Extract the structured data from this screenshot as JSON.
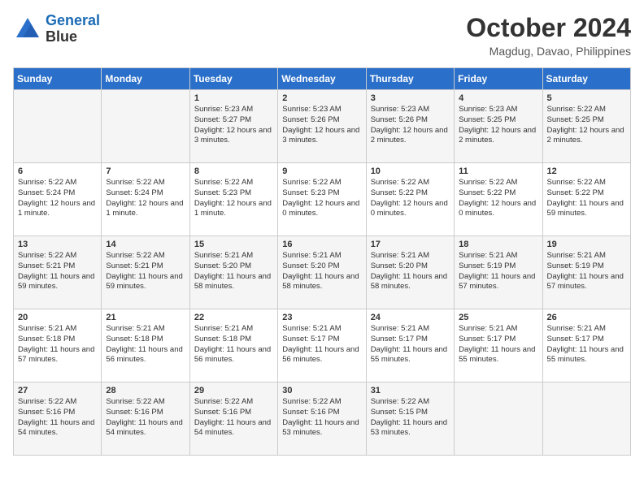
{
  "header": {
    "logo_line1": "General",
    "logo_line2": "Blue",
    "month": "October 2024",
    "location": "Magdug, Davao, Philippines"
  },
  "days_of_week": [
    "Sunday",
    "Monday",
    "Tuesday",
    "Wednesday",
    "Thursday",
    "Friday",
    "Saturday"
  ],
  "weeks": [
    [
      {
        "day": "",
        "content": ""
      },
      {
        "day": "",
        "content": ""
      },
      {
        "day": "1",
        "content": "Sunrise: 5:23 AM\nSunset: 5:27 PM\nDaylight: 12 hours\nand 3 minutes."
      },
      {
        "day": "2",
        "content": "Sunrise: 5:23 AM\nSunset: 5:26 PM\nDaylight: 12 hours\nand 3 minutes."
      },
      {
        "day": "3",
        "content": "Sunrise: 5:23 AM\nSunset: 5:26 PM\nDaylight: 12 hours\nand 2 minutes."
      },
      {
        "day": "4",
        "content": "Sunrise: 5:23 AM\nSunset: 5:25 PM\nDaylight: 12 hours\nand 2 minutes."
      },
      {
        "day": "5",
        "content": "Sunrise: 5:22 AM\nSunset: 5:25 PM\nDaylight: 12 hours\nand 2 minutes."
      }
    ],
    [
      {
        "day": "6",
        "content": "Sunrise: 5:22 AM\nSunset: 5:24 PM\nDaylight: 12 hours\nand 1 minute."
      },
      {
        "day": "7",
        "content": "Sunrise: 5:22 AM\nSunset: 5:24 PM\nDaylight: 12 hours\nand 1 minute."
      },
      {
        "day": "8",
        "content": "Sunrise: 5:22 AM\nSunset: 5:23 PM\nDaylight: 12 hours\nand 1 minute."
      },
      {
        "day": "9",
        "content": "Sunrise: 5:22 AM\nSunset: 5:23 PM\nDaylight: 12 hours\nand 0 minutes."
      },
      {
        "day": "10",
        "content": "Sunrise: 5:22 AM\nSunset: 5:22 PM\nDaylight: 12 hours\nand 0 minutes."
      },
      {
        "day": "11",
        "content": "Sunrise: 5:22 AM\nSunset: 5:22 PM\nDaylight: 12 hours\nand 0 minutes."
      },
      {
        "day": "12",
        "content": "Sunrise: 5:22 AM\nSunset: 5:22 PM\nDaylight: 11 hours\nand 59 minutes."
      }
    ],
    [
      {
        "day": "13",
        "content": "Sunrise: 5:22 AM\nSunset: 5:21 PM\nDaylight: 11 hours\nand 59 minutes."
      },
      {
        "day": "14",
        "content": "Sunrise: 5:22 AM\nSunset: 5:21 PM\nDaylight: 11 hours\nand 59 minutes."
      },
      {
        "day": "15",
        "content": "Sunrise: 5:21 AM\nSunset: 5:20 PM\nDaylight: 11 hours\nand 58 minutes."
      },
      {
        "day": "16",
        "content": "Sunrise: 5:21 AM\nSunset: 5:20 PM\nDaylight: 11 hours\nand 58 minutes."
      },
      {
        "day": "17",
        "content": "Sunrise: 5:21 AM\nSunset: 5:20 PM\nDaylight: 11 hours\nand 58 minutes."
      },
      {
        "day": "18",
        "content": "Sunrise: 5:21 AM\nSunset: 5:19 PM\nDaylight: 11 hours\nand 57 minutes."
      },
      {
        "day": "19",
        "content": "Sunrise: 5:21 AM\nSunset: 5:19 PM\nDaylight: 11 hours\nand 57 minutes."
      }
    ],
    [
      {
        "day": "20",
        "content": "Sunrise: 5:21 AM\nSunset: 5:18 PM\nDaylight: 11 hours\nand 57 minutes."
      },
      {
        "day": "21",
        "content": "Sunrise: 5:21 AM\nSunset: 5:18 PM\nDaylight: 11 hours\nand 56 minutes."
      },
      {
        "day": "22",
        "content": "Sunrise: 5:21 AM\nSunset: 5:18 PM\nDaylight: 11 hours\nand 56 minutes."
      },
      {
        "day": "23",
        "content": "Sunrise: 5:21 AM\nSunset: 5:17 PM\nDaylight: 11 hours\nand 56 minutes."
      },
      {
        "day": "24",
        "content": "Sunrise: 5:21 AM\nSunset: 5:17 PM\nDaylight: 11 hours\nand 55 minutes."
      },
      {
        "day": "25",
        "content": "Sunrise: 5:21 AM\nSunset: 5:17 PM\nDaylight: 11 hours\nand 55 minutes."
      },
      {
        "day": "26",
        "content": "Sunrise: 5:21 AM\nSunset: 5:17 PM\nDaylight: 11 hours\nand 55 minutes."
      }
    ],
    [
      {
        "day": "27",
        "content": "Sunrise: 5:22 AM\nSunset: 5:16 PM\nDaylight: 11 hours\nand 54 minutes."
      },
      {
        "day": "28",
        "content": "Sunrise: 5:22 AM\nSunset: 5:16 PM\nDaylight: 11 hours\nand 54 minutes."
      },
      {
        "day": "29",
        "content": "Sunrise: 5:22 AM\nSunset: 5:16 PM\nDaylight: 11 hours\nand 54 minutes."
      },
      {
        "day": "30",
        "content": "Sunrise: 5:22 AM\nSunset: 5:16 PM\nDaylight: 11 hours\nand 53 minutes."
      },
      {
        "day": "31",
        "content": "Sunrise: 5:22 AM\nSunset: 5:15 PM\nDaylight: 11 hours\nand 53 minutes."
      },
      {
        "day": "",
        "content": ""
      },
      {
        "day": "",
        "content": ""
      }
    ]
  ]
}
